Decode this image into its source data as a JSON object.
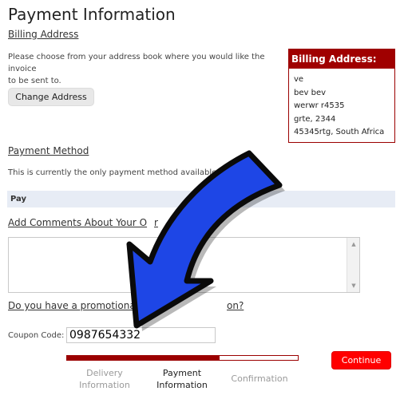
{
  "page": {
    "title": "Payment Information"
  },
  "billing": {
    "section_link": "Billing Address",
    "instructions_line1": "Please choose from your address book where you would like the invoice",
    "instructions_line2": "to be sent to.",
    "change_button": "Change Address",
    "box_title": "Billing Address:",
    "address_lines": [
      "ve",
      "bev bev",
      "werwr r4535",
      "grte, 2344",
      "45345rtg, South Africa"
    ]
  },
  "payment": {
    "section_link": "Payment Method",
    "only_method_text": "This is currently the only payment method available to",
    "method_label": "Pay"
  },
  "comments": {
    "section_link": "Add Comments About Your O",
    "section_link_tail": "r",
    "value": ""
  },
  "promo": {
    "question_start": "Do you have a promotional c",
    "question_end": "on?",
    "coupon_label": "Coupon Code:",
    "coupon_value": "0987654332"
  },
  "checkout": {
    "progress_fraction": 0.66,
    "steps": [
      {
        "line1": "Delivery",
        "line2": "Information",
        "state": "done"
      },
      {
        "line1": "Payment",
        "line2": "Information",
        "state": "current"
      },
      {
        "line1": "Confirmation",
        "line2": "",
        "state": "pending"
      }
    ],
    "continue_button": "Continue"
  },
  "colors": {
    "accent_dark_red": "#9b0000",
    "continue_red": "#ff0000",
    "pay_bar_bg": "#e7ecf5",
    "overlay_arrow_blue": "#1e46e6"
  },
  "icons": {
    "scroll_up": "triangle-up-icon",
    "scroll_down": "triangle-down-icon",
    "overlay": "blue-arrow-icon"
  }
}
